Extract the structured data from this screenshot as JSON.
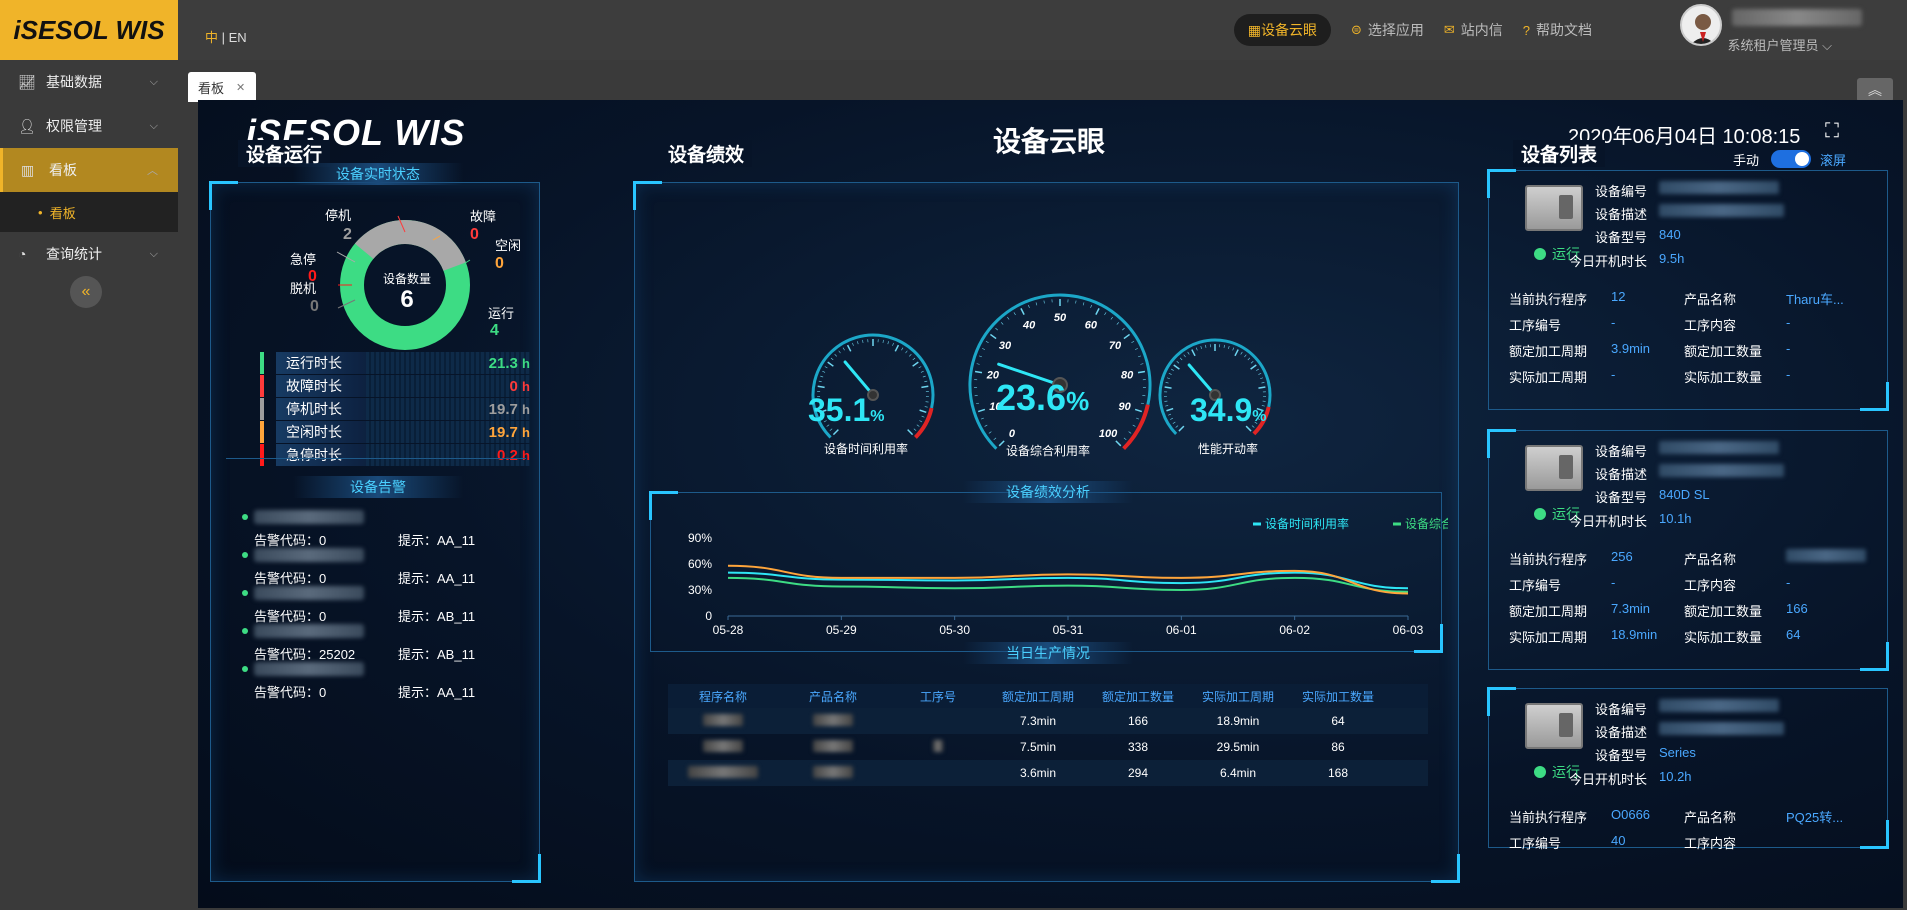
{
  "app": {
    "logo": "iSESOL WIS",
    "lang": {
      "zh": "中",
      "sep": " | ",
      "en": "EN"
    }
  },
  "topnav": {
    "pill": "设备云眼",
    "items": [
      {
        "icon": "apps-icon",
        "label": "选择应用"
      },
      {
        "icon": "mail-icon",
        "label": "站内信"
      },
      {
        "icon": "help-icon",
        "label": "帮助文档"
      }
    ],
    "user_role": "系统租户管理员"
  },
  "sidebar": {
    "items": [
      {
        "label": "基础数据"
      },
      {
        "label": "权限管理"
      },
      {
        "label": "看板"
      },
      {
        "label": "查询统计"
      }
    ],
    "sub_item": "看板"
  },
  "tab": {
    "label": "看板"
  },
  "dashboard": {
    "logo": "iSESOL WIS",
    "title": "设备云眼",
    "datetime": "2020年06月04日 10:08:15",
    "mode_manual": "手动",
    "mode_scroll": "滚屏",
    "left": {
      "title": "设备运行",
      "status_title": "设备实时状态",
      "donut_center_label": "设备数量",
      "donut_center_value": "6",
      "legend": [
        {
          "label": "停机",
          "value": "2",
          "color": "#9e9e9e"
        },
        {
          "label": "故障",
          "value": "0",
          "color": "#ff3b3b"
        },
        {
          "label": "空闲",
          "value": "0",
          "color": "#ffa53b"
        },
        {
          "label": "急停",
          "value": "0",
          "color": "#ff1a1a"
        },
        {
          "label": "脱机",
          "value": "0",
          "color": "#777777"
        },
        {
          "label": "运行",
          "value": "4",
          "color": "#3ddc84"
        }
      ],
      "durations": [
        {
          "label": "运行时长",
          "value": "21.3",
          "unit": "h",
          "color": "#3ddc84"
        },
        {
          "label": "故障时长",
          "value": "0",
          "unit": "h",
          "color": "#ff3b3b"
        },
        {
          "label": "停机时长",
          "value": "19.7",
          "unit": "h",
          "color": "#9e9e9e"
        },
        {
          "label": "空闲时长",
          "value": "19.7",
          "unit": "h",
          "color": "#ffa53b"
        },
        {
          "label": "急停时长",
          "value": "0.2",
          "unit": "h",
          "color": "#ff1a1a"
        }
      ],
      "alarm_title": "设备告警",
      "alarms": [
        {
          "code": "告警代码：0",
          "hint": "提示：AA_11"
        },
        {
          "code": "告警代码：0",
          "hint": "提示：AA_11"
        },
        {
          "code": "告警代码：0",
          "hint": "提示：AB_11"
        },
        {
          "code": "告警代码：25202",
          "hint": "提示：AB_11"
        },
        {
          "code": "告警代码：0",
          "hint": "提示：AA_11"
        }
      ]
    },
    "center": {
      "title": "设备绩效",
      "gauges": [
        {
          "label": "设备时间利用率",
          "value": "35.1",
          "unit": "%",
          "fraction": 0.351
        },
        {
          "label": "设备综合利用率",
          "value": "23.6",
          "unit": "%",
          "fraction": 0.236,
          "ticks": [
            "0",
            "10",
            "20",
            "30",
            "40",
            "50",
            "60",
            "70",
            "80",
            "90",
            "100"
          ]
        },
        {
          "label": "性能开动率",
          "value": "34.9",
          "unit": "%",
          "fraction": 0.349
        }
      ],
      "analysis_title": "设备绩效分析",
      "production_title": "当日生产情况",
      "table": {
        "headers": [
          "程序名称",
          "产品名称",
          "工序号",
          "额定加工周期",
          "额定加工数量",
          "实际加工周期",
          "实际加工数量"
        ],
        "rows": [
          [
            "",
            "",
            "",
            "7.3min",
            "166",
            "18.9min",
            "64"
          ],
          [
            "",
            "",
            "",
            "7.5min",
            "338",
            "29.5min",
            "86"
          ],
          [
            "",
            "",
            "",
            "3.6min",
            "294",
            "6.4min",
            "168"
          ]
        ]
      }
    },
    "right": {
      "title": "设备列表",
      "labels": {
        "code": "设备编号",
        "desc": "设备描述",
        "model": "设备型号",
        "today": "今日开机时长",
        "program": "当前执行程序",
        "product": "产品名称",
        "proc_no": "工序编号",
        "proc_content": "工序内容",
        "rated_cycle": "额定加工周期",
        "rated_qty": "额定加工数量",
        "actual_cycle": "实际加工周期",
        "actual_qty": "实际加工数量"
      },
      "devices": [
        {
          "status": "运行",
          "model": "840",
          "today": "9.5h",
          "program": "12",
          "product": "Tharu车...",
          "proc_no": "-",
          "proc_content": "-",
          "rated_cycle": "3.9min",
          "rated_qty": "-",
          "actual_cycle": "-",
          "actual_qty": "-"
        },
        {
          "status": "运行",
          "model": "840D SL",
          "today": "10.1h",
          "program": "256",
          "product": "",
          "proc_no": "-",
          "proc_content": "-",
          "rated_cycle": "7.3min",
          "rated_qty": "166",
          "actual_cycle": "18.9min",
          "actual_qty": "64"
        },
        {
          "status": "运行",
          "model": "Series",
          "today": "10.2h",
          "program": "O0666",
          "product": "PQ25转...",
          "proc_no": "40",
          "proc_content": "",
          "rated_cycle": "",
          "rated_qty": "",
          "actual_cycle": "",
          "actual_qty": ""
        }
      ]
    }
  },
  "chart_data": {
    "type": "line",
    "categories": [
      "05-28",
      "05-29",
      "05-30",
      "05-31",
      "06-01",
      "06-02",
      "06-03"
    ],
    "ylim": [
      0,
      90
    ],
    "yticks": [
      "0",
      "30%",
      "60%",
      "90%"
    ],
    "series": [
      {
        "name": "设备时间利用率",
        "color": "#2ee6f5",
        "values": [
          50,
          42,
          41,
          44,
          38,
          50,
          32
        ]
      },
      {
        "name": "设备综合利用率",
        "color": "#3ddc84",
        "values": [
          44,
          34,
          32,
          35,
          30,
          44,
          28
        ]
      },
      {
        "name": "性能开动率",
        "color": "#ffa53b",
        "values": [
          58,
          44,
          44,
          48,
          44,
          52,
          26
        ]
      }
    ]
  }
}
